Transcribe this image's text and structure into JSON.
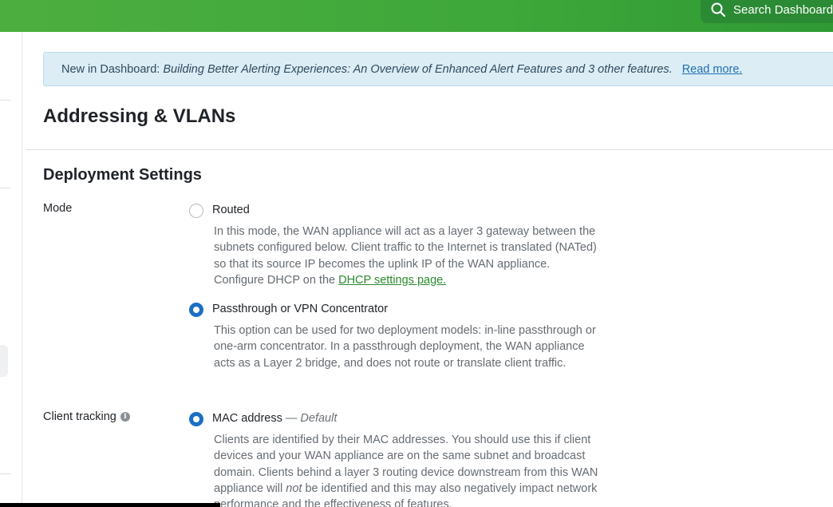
{
  "header": {
    "search_placeholder": "Search Dashboard"
  },
  "banner": {
    "intro": "New in Dashboard:",
    "features": "Building Better Alerting Experiences: An Overview of Enhanced Alert Features and 3 other features.",
    "read_more": "Read more."
  },
  "page": {
    "title": "Addressing & VLANs"
  },
  "deployment": {
    "section_title": "Deployment Settings",
    "mode": {
      "label": "Mode",
      "options": [
        {
          "label": "Routed",
          "selected": false,
          "desc_lines": [
            "In this mode, the WAN appliance will act as a layer 3 gateway between the",
            "subnets configured below. Client traffic to the Internet is translated (NATed)",
            "so that its source IP becomes the uplink IP of the WAN appliance."
          ],
          "desc_last_prefix": "Configure DHCP on the",
          "desc_link": "DHCP settings page."
        },
        {
          "label": "Passthrough or VPN Concentrator",
          "selected": true,
          "desc_lines": [
            "This option can be used for two deployment models: in-line passthrough or",
            "one-arm concentrator. In a passthrough deployment, the WAN appliance",
            "acts as a Layer 2 bridge, and does not route or translate client traffic."
          ]
        }
      ]
    },
    "client_tracking": {
      "label": "Client tracking",
      "info_icon": "i",
      "options": [
        {
          "label": "MAC address",
          "separator": "—",
          "suffix": "Default",
          "selected": true,
          "desc_lines": [
            "Clients are identified by their MAC addresses. You should use this if client",
            "devices and your WAN appliance are on the same subnet and broadcast",
            "domain. Clients behind a layer 3 routing device downstream from this WAN"
          ],
          "desc_line4_a": "appliance will",
          "desc_line4_em": "not",
          "desc_line4_b": "be identified and this may also negatively impact network",
          "desc_line5": "performance and the effectiveness of features."
        }
      ]
    }
  },
  "colors": {
    "topbar_green": "#3ea83a",
    "radio_selected": "#1b6fc4",
    "link_green": "#2a8a2e",
    "banner_bg": "#dcedf6"
  }
}
